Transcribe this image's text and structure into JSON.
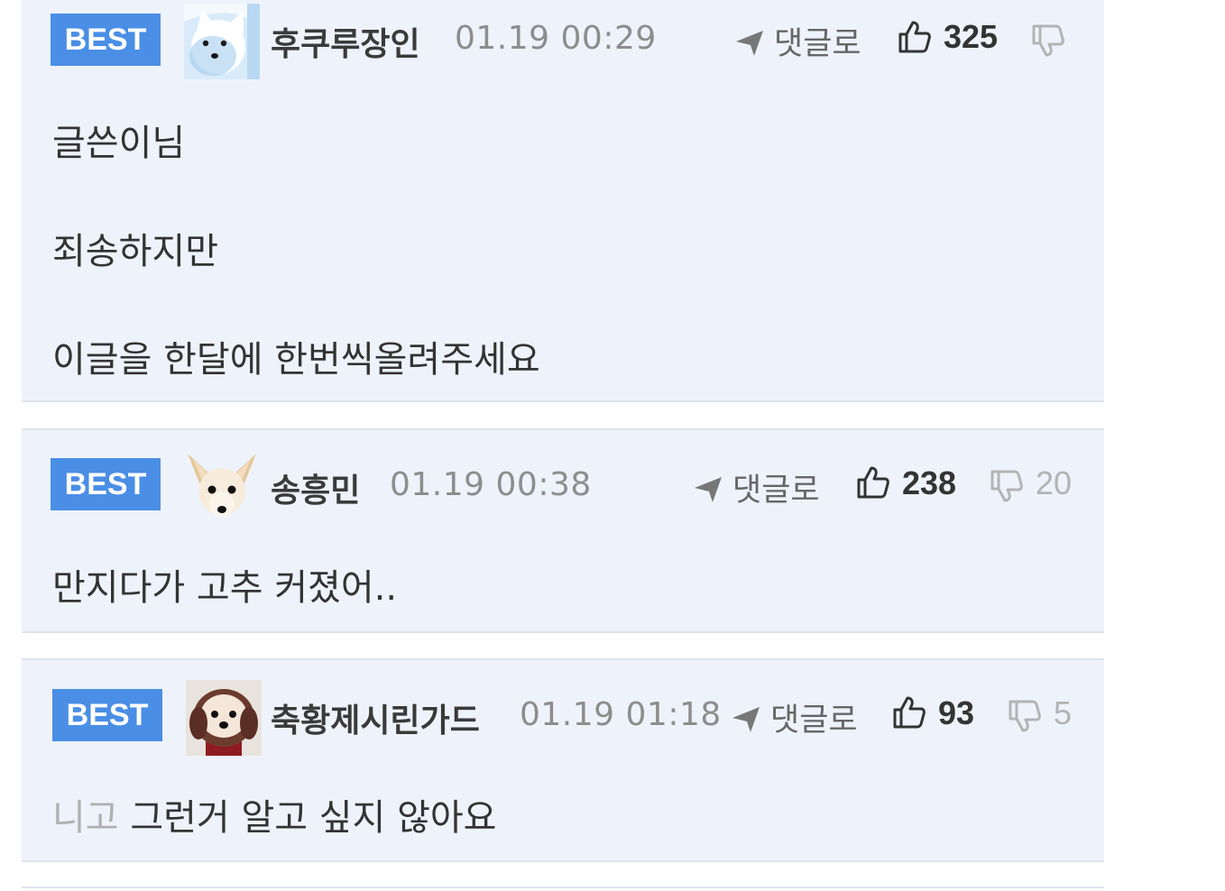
{
  "comments": [
    {
      "badge": "BEST",
      "username": "후쿠루장인",
      "date": "01.19 00:29",
      "reply_label": "댓글로",
      "likes": "325",
      "dislikes": "",
      "avatar_icon": "white-dog-avatar",
      "lines": [
        "글쓴이님",
        "죄송하지만",
        "이글을 한달에 한번씩올려주세요"
      ]
    },
    {
      "badge": "BEST",
      "username": "송흥민",
      "date": "01.19 00:38",
      "reply_label": "댓글로",
      "likes": "238",
      "dislikes": "20",
      "avatar_icon": "chihuahua-avatar",
      "lines": [
        "만지다가 고추 커졌어.."
      ]
    },
    {
      "badge": "BEST",
      "username": "축황제시린가드",
      "date": "01.19 01:18",
      "reply_label": "댓글로",
      "likes": "93",
      "dislikes": "5",
      "avatar_icon": "puppy-avatar",
      "line_prefix": "니고",
      "lines": [
        "그런거 알고 싶지 않아요"
      ]
    }
  ],
  "colors": {
    "badge": "#4a8ee6",
    "card_background": "#eef3fb",
    "separator": "#dfe4ec"
  }
}
